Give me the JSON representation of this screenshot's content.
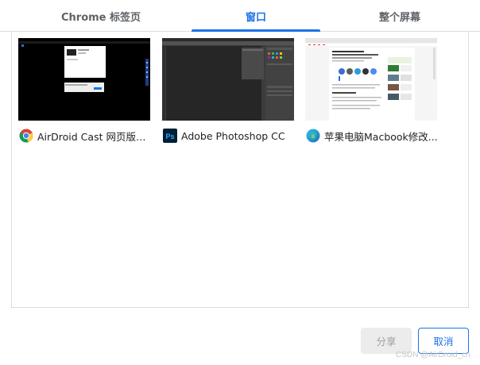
{
  "tabs": [
    {
      "label": "Chrome 标签页",
      "active": false
    },
    {
      "label": "窗口",
      "active": true
    },
    {
      "label": "整个屏幕",
      "active": false
    }
  ],
  "windows": [
    {
      "title": "AirDroid Cast 网页版：...",
      "icon": "chrome-icon",
      "thumbnail": "screen-share-page-preview"
    },
    {
      "title": "Adobe Photoshop CC",
      "icon": "photoshop-icon",
      "thumbnail": "photoshop-workspace-preview"
    },
    {
      "title": "苹果电脑Macbook修改...",
      "icon": "edge-icon",
      "thumbnail": "web-article-preview"
    }
  ],
  "buttons": {
    "share": "分享",
    "cancel": "取消"
  },
  "watermark": "CSDN @AirDroid_cn",
  "colors": {
    "accent": "#1a73e8",
    "tab_inactive": "#5f6368",
    "border": "#dadce0",
    "share_bg": "#ececec"
  }
}
